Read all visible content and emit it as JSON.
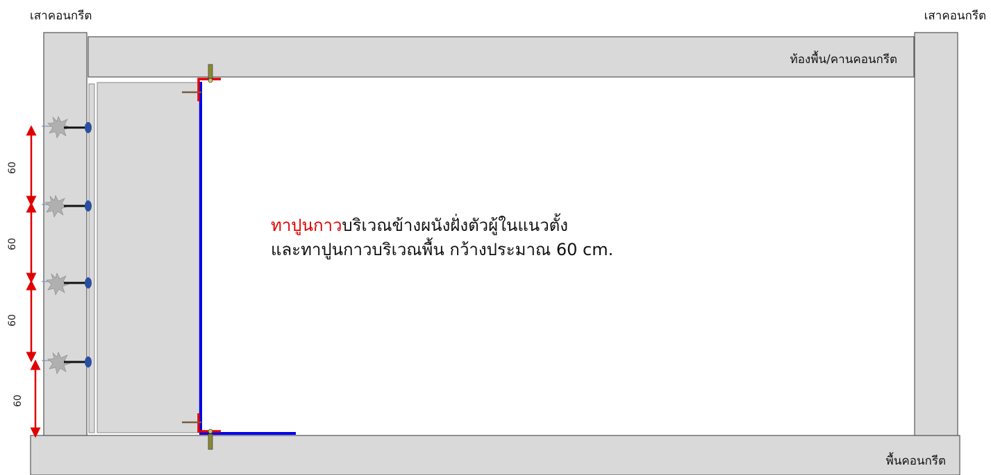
{
  "labels": {
    "column_left": "เสาคอนกรีต",
    "column_right": "เสาคอนกรีต",
    "beam": "ท้องพื้น/คานคอนกรีต",
    "floor": "พื้นคอนกรีต"
  },
  "note": {
    "line1_highlight": "ทาปูนกาว",
    "line1_rest": "บริเวณข้างผนังฝั่งตัวผู้ในแนวตั้ง",
    "line2": "และทาปูนกาวบริเวณพื้น กว้างประมาณ 60 cm."
  },
  "dimensions": [
    "60",
    "60",
    "60",
    "60"
  ],
  "colors": {
    "concrete": "#d9d9d9",
    "outline": "#555555",
    "channel": "#0000ee",
    "angle": "#e00000",
    "highlight_text": "#e00000",
    "dimension_arrow": "#e00000",
    "anchor": "#2a4fa0"
  },
  "icons": [
    "anchor-bolt-icon",
    "burst-icon",
    "screw-icon"
  ]
}
